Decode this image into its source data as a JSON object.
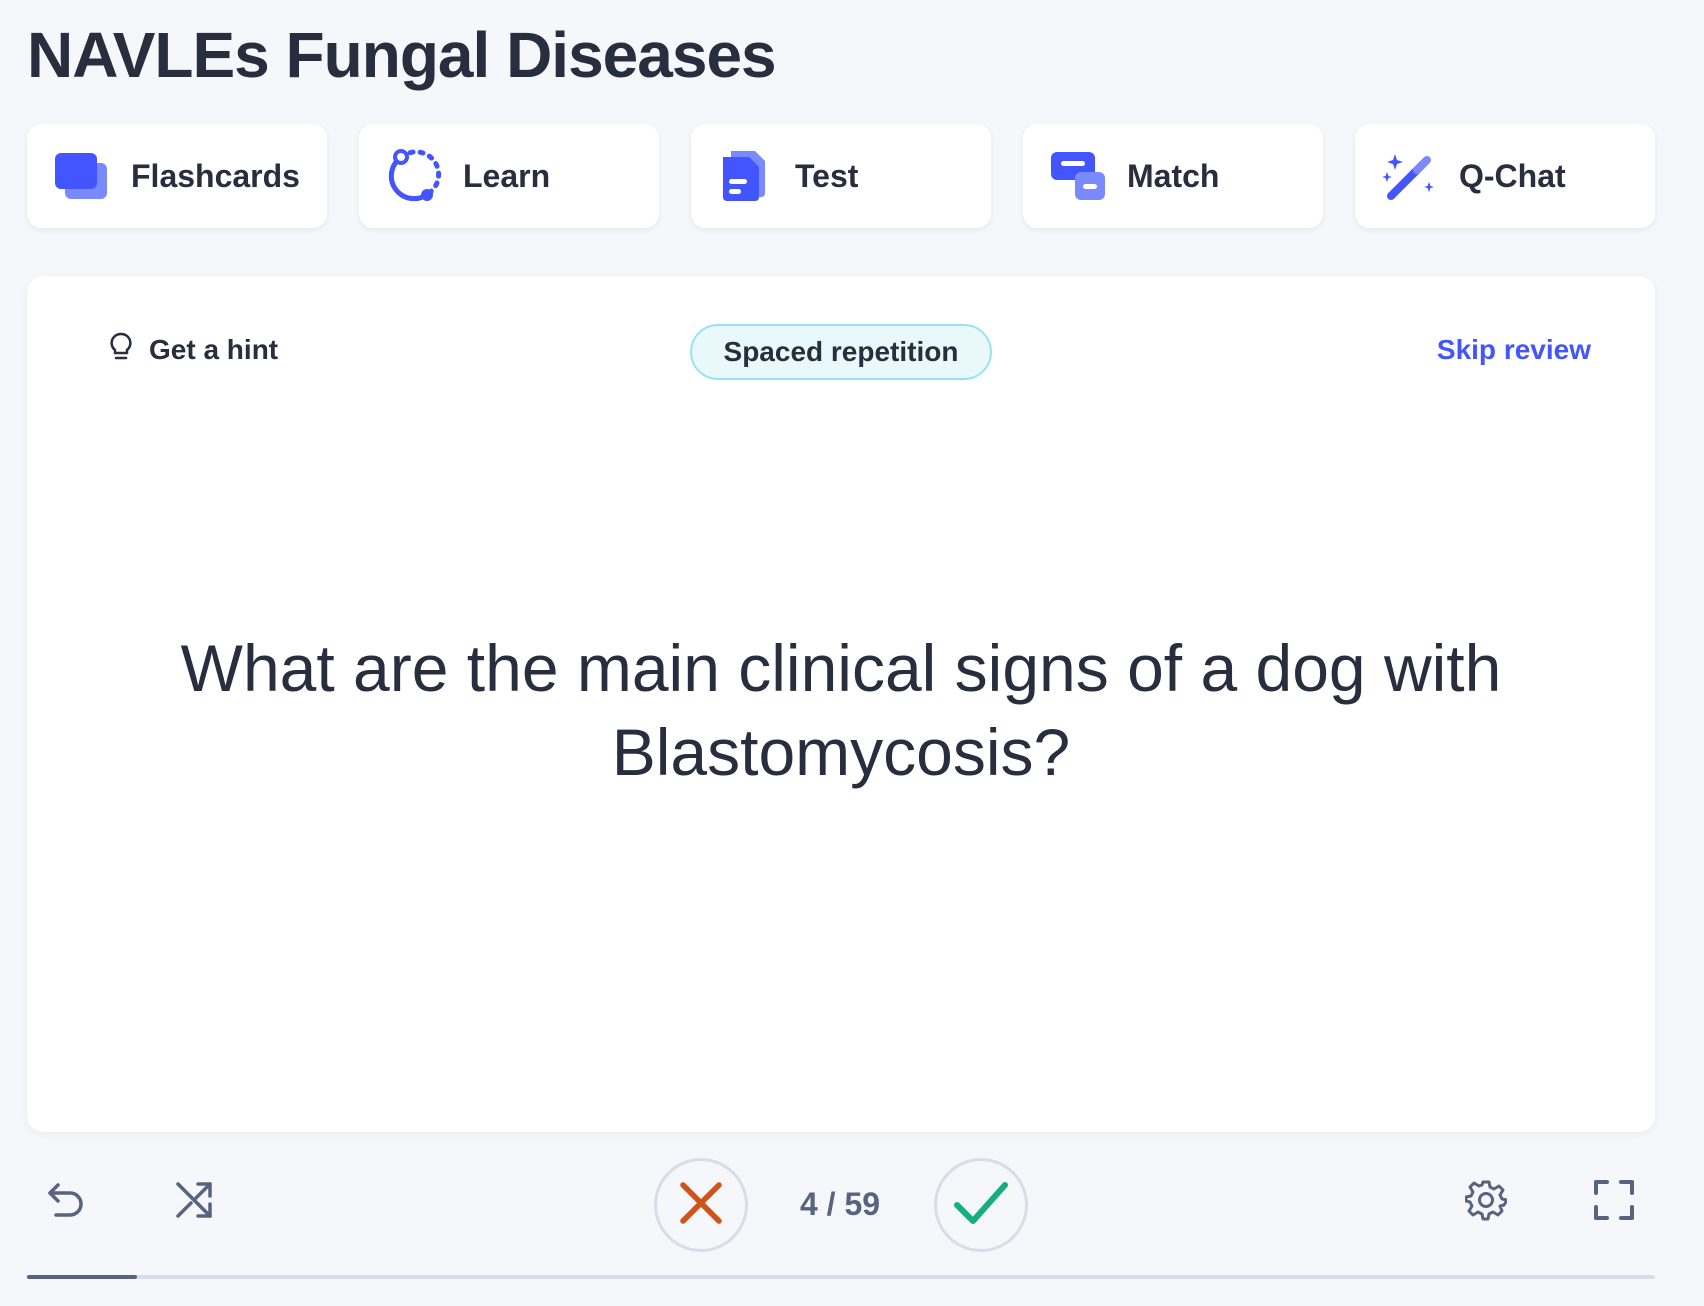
{
  "page_title": "NAVLEs Fungal Diseases",
  "modes": [
    {
      "label": "Flashcards",
      "icon": "flashcards-icon"
    },
    {
      "label": "Learn",
      "icon": "learn-icon"
    },
    {
      "label": "Test",
      "icon": "test-icon"
    },
    {
      "label": "Match",
      "icon": "match-icon"
    },
    {
      "label": "Q-Chat",
      "icon": "magic-wand-icon"
    }
  ],
  "card": {
    "hint_label": "Get a hint",
    "badge": "Spaced repetition",
    "skip_label": "Skip review",
    "question": "What are the main clinical signs of a dog with Blastomycosis?"
  },
  "controls": {
    "counter": "4 / 59",
    "undo_icon": "undo-icon",
    "shuffle_icon": "shuffle-icon",
    "incorrect_icon": "x-icon",
    "correct_icon": "check-icon",
    "settings_icon": "gear-icon",
    "fullscreen_icon": "fullscreen-icon"
  },
  "progress": {
    "current": 4,
    "total": 59
  },
  "colors": {
    "accent": "#4255ff",
    "incorrect": "#d0531a",
    "correct": "#18ae79",
    "badge_border": "#98e3ef"
  }
}
